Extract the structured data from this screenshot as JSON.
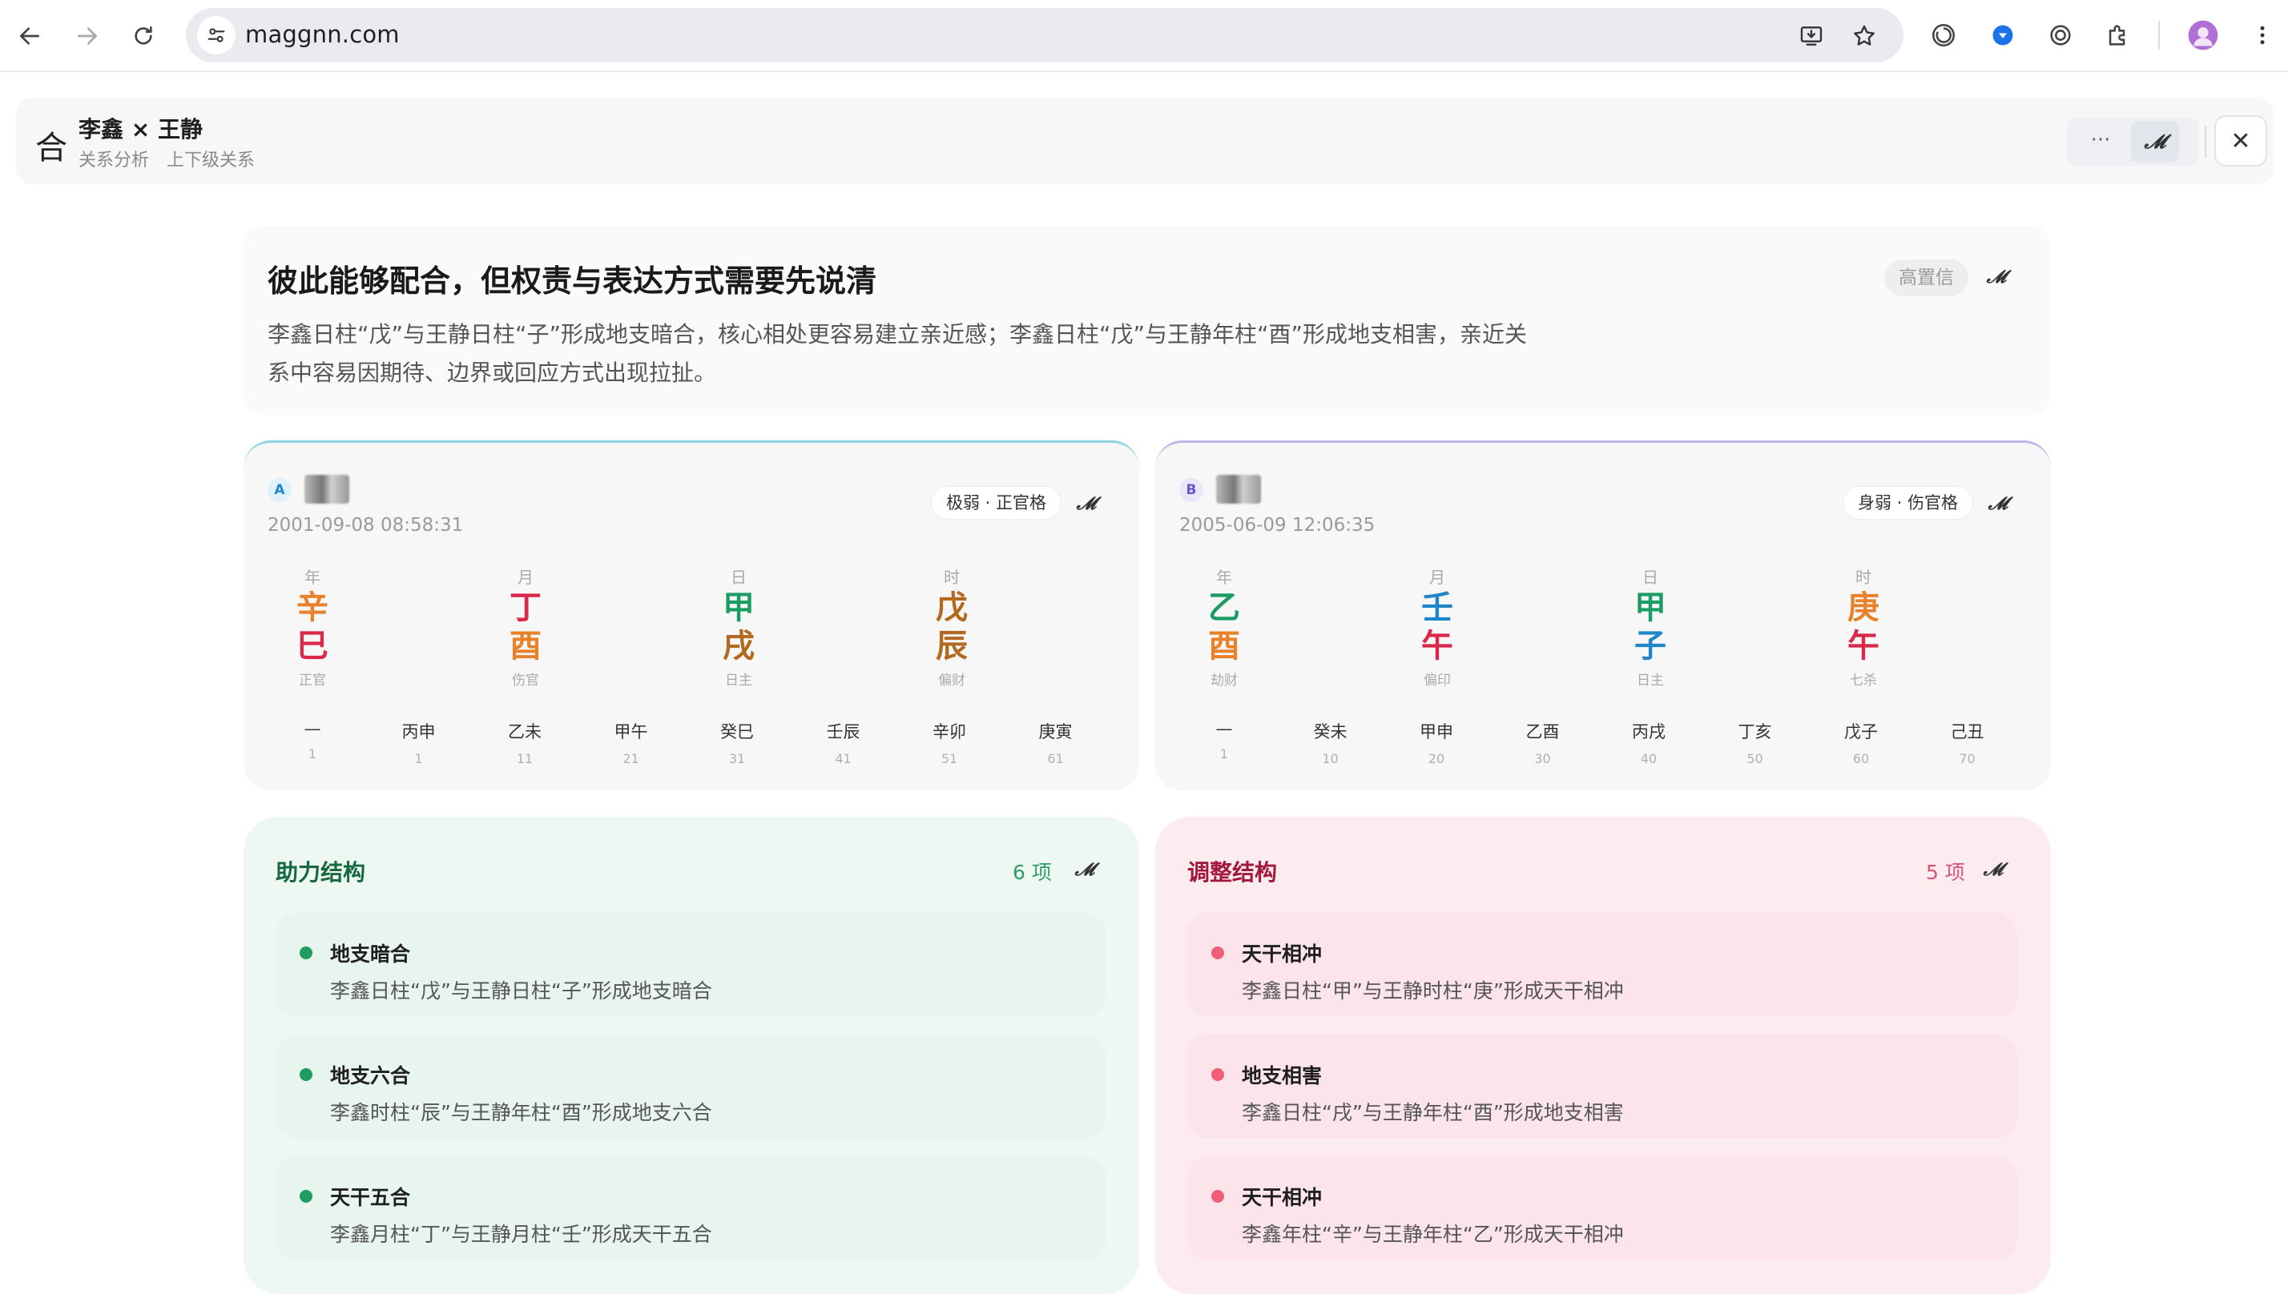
{
  "browser": {
    "url": "maggnn.com"
  },
  "header": {
    "icon_glyph": "合",
    "title": "李鑫 × 王静",
    "tags": [
      "关系分析",
      "上下级关系"
    ],
    "more_glyph": "···",
    "close_glyph": "✕"
  },
  "summary": {
    "title": "彼此能够配合，但权责与表达方式需要先说清",
    "body": "李鑫日柱“戊”与王静日柱“子”形成地支暗合，核心相处更容易建立亲近感；李鑫日柱“戊”与王静年柱“酉”形成地支相害，亲近关系中容易因期待、边界或回应方式出现拉扯。",
    "badge": "高置信"
  },
  "person_a": {
    "badge": "A",
    "name": "李",
    "datetime": "2001-09-08 08:58:31",
    "tag": "极弱 · 正官格",
    "accent": "#7cc9e0",
    "pillars": [
      {
        "label": "年",
        "gan": "辛",
        "zhi": "巳",
        "sub": "正官",
        "gan_color": "#e8822a",
        "zhi_color": "#d9284a"
      },
      {
        "label": "月",
        "gan": "丁",
        "zhi": "酉",
        "sub": "伤官",
        "gan_color": "#d9284a",
        "zhi_color": "#e8822a"
      },
      {
        "label": "日",
        "gan": "甲",
        "zhi": "戌",
        "sub": "日主",
        "gan_color": "#1a9c63",
        "zhi_color": "#b36a1e"
      },
      {
        "label": "时",
        "gan": "戊",
        "zhi": "辰",
        "sub": "偏财",
        "gan_color": "#b36a1e",
        "zhi_color": "#b36a1e"
      }
    ],
    "dayun": [
      {
        "gz": "—",
        "age": "1"
      },
      {
        "gz": "丙申",
        "age": "1"
      },
      {
        "gz": "乙未",
        "age": "11"
      },
      {
        "gz": "甲午",
        "age": "21"
      },
      {
        "gz": "癸巳",
        "age": "31"
      },
      {
        "gz": "壬辰",
        "age": "41"
      },
      {
        "gz": "辛卯",
        "age": "51"
      },
      {
        "gz": "庚寅",
        "age": "61"
      }
    ]
  },
  "person_b": {
    "badge": "B",
    "name": "王",
    "datetime": "2005-06-09 12:06:35",
    "tag": "身弱 · 伤官格",
    "accent": "#b7b1e6",
    "pillars": [
      {
        "label": "年",
        "gan": "乙",
        "zhi": "酉",
        "sub": "劫财",
        "gan_color": "#1a9c63",
        "zhi_color": "#e8822a"
      },
      {
        "label": "月",
        "gan": "壬",
        "zhi": "午",
        "sub": "偏印",
        "gan_color": "#1f86c9",
        "zhi_color": "#d9284a"
      },
      {
        "label": "日",
        "gan": "甲",
        "zhi": "子",
        "sub": "日主",
        "gan_color": "#1a9c63",
        "zhi_color": "#1f86c9"
      },
      {
        "label": "时",
        "gan": "庚",
        "zhi": "午",
        "sub": "七杀",
        "gan_color": "#e8822a",
        "zhi_color": "#d9284a"
      }
    ],
    "dayun": [
      {
        "gz": "—",
        "age": "1"
      },
      {
        "gz": "癸未",
        "age": "10"
      },
      {
        "gz": "甲申",
        "age": "20"
      },
      {
        "gz": "乙酉",
        "age": "30"
      },
      {
        "gz": "丙戌",
        "age": "40"
      },
      {
        "gz": "丁亥",
        "age": "50"
      },
      {
        "gz": "戊子",
        "age": "60"
      },
      {
        "gz": "己丑",
        "age": "70"
      }
    ]
  },
  "help": {
    "title": "助力结构",
    "count": "6 项",
    "items": [
      {
        "title": "地支暗合",
        "desc": "李鑫日柱“戊”与王静日柱“子”形成地支暗合"
      },
      {
        "title": "地支六合",
        "desc": "李鑫时柱“辰”与王静年柱“酉”形成地支六合"
      },
      {
        "title": "天干五合",
        "desc": "李鑫月柱“丁”与王静月柱“壬”形成天干五合"
      }
    ]
  },
  "adjust": {
    "title": "调整结构",
    "count": "5 项",
    "items": [
      {
        "title": "天干相冲",
        "desc": "李鑫日柱“甲”与王静时柱“庚”形成天干相冲"
      },
      {
        "title": "地支相害",
        "desc": "李鑫日柱“戌”与王静年柱“酉”形成地支相害"
      },
      {
        "title": "天干相冲",
        "desc": "李鑫年柱“辛”与王静年柱“乙”形成天干相冲"
      }
    ]
  },
  "icons": {
    "script_glyph": "𝓜"
  }
}
